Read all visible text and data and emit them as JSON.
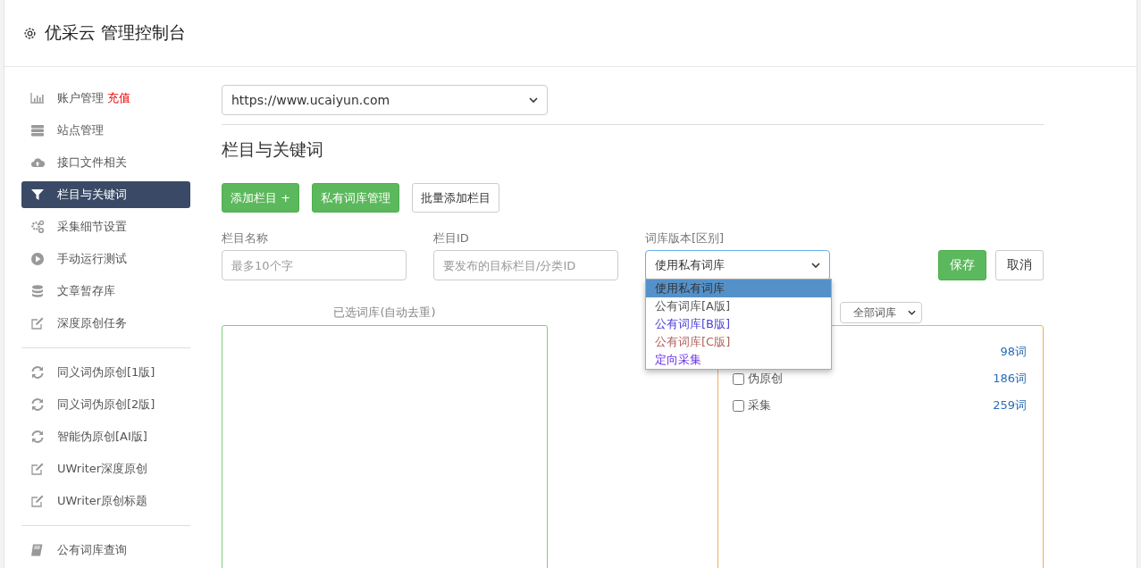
{
  "header": {
    "title": "优采云 管理控制台"
  },
  "sidebar": {
    "sections": [
      [
        {
          "label": "账户管理",
          "badge": "充值",
          "kind": "chart",
          "selected": false
        },
        {
          "label": "站点管理",
          "kind": "server",
          "selected": false
        },
        {
          "label": "接口文件相关",
          "kind": "cloud",
          "selected": false
        },
        {
          "label": "栏目与关键词",
          "kind": "filter",
          "selected": true
        },
        {
          "label": "采集细节设置",
          "kind": "gears",
          "selected": false
        },
        {
          "label": "手动运行测试",
          "kind": "play",
          "selected": false
        },
        {
          "label": "文章暂存库",
          "kind": "database",
          "selected": false
        },
        {
          "label": "深度原创任务",
          "kind": "edit",
          "selected": false
        }
      ],
      [
        {
          "label": "同义词伪原创[1版]",
          "kind": "refresh",
          "selected": false
        },
        {
          "label": "同义词伪原创[2版]",
          "kind": "refresh",
          "selected": false
        },
        {
          "label": "智能伪原创[AI版]",
          "kind": "refresh",
          "selected": false
        },
        {
          "label": "UWriter深度原创",
          "kind": "edit",
          "selected": false
        },
        {
          "label": "UWriter原创标题",
          "kind": "edit",
          "selected": false
        }
      ],
      [
        {
          "label": "公有词库查询",
          "kind": "book",
          "selected": false
        }
      ]
    ]
  },
  "site_select": {
    "value": "https://www.ucaiyun.com"
  },
  "heading": "栏目与关键词",
  "toolbar": [
    {
      "label": "添加栏目 +",
      "kind": "success"
    },
    {
      "label": "私有词库管理",
      "kind": "success"
    },
    {
      "label": "批量添加栏目",
      "kind": "default"
    }
  ],
  "form": {
    "name_field": {
      "label": "栏目名称",
      "placeholder": "最多10个字"
    },
    "id_field": {
      "label": "栏目ID",
      "placeholder": "要发布的目标栏目/分类ID"
    },
    "version_select": {
      "label": "词库版本[区别]",
      "value": "使用私有词库",
      "expanded": true,
      "options": [
        {
          "label": "使用私有词库",
          "selected": true
        },
        {
          "label": "公有词库[A版]",
          "selected": false,
          "color": "#555555"
        },
        {
          "label": "公有词库[B版]",
          "selected": false,
          "color": "#4a3fd6"
        },
        {
          "label": "公有词库[C版]",
          "selected": false,
          "color": "#b0605a"
        },
        {
          "label": "定向采集",
          "selected": false,
          "color": "#6a2ee8"
        }
      ]
    },
    "buttons": [
      {
        "label": "保存",
        "kind": "success"
      },
      {
        "label": "取消",
        "kind": "default"
      }
    ]
  },
  "selected_label": "已选词库(自动去重)",
  "library_filter": {
    "value": "全部词库"
  },
  "libraries": [
    {
      "count": "98词"
    },
    {
      "label": "伪原创",
      "count": "186词",
      "checked": false
    },
    {
      "label": "采集",
      "count": "259词",
      "checked": false
    }
  ]
}
